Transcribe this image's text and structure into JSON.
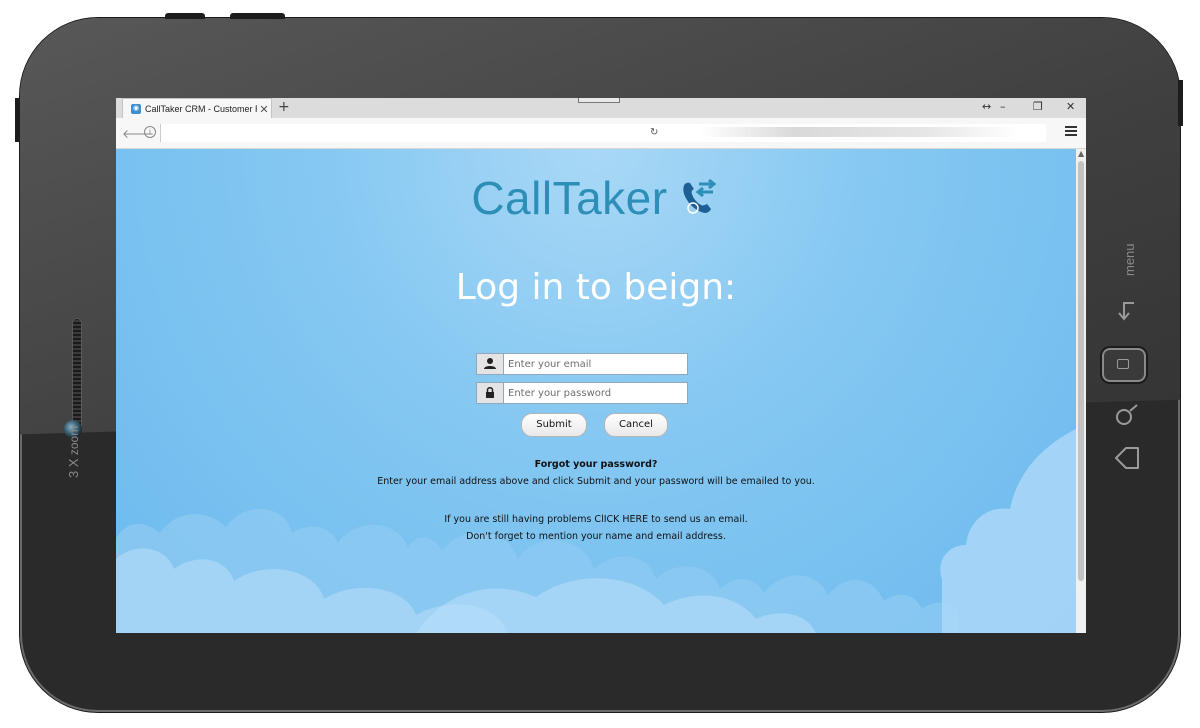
{
  "device": {
    "zoom_label": "zoom",
    "zoom_value": "3 X",
    "menu_label": "menu"
  },
  "browser": {
    "tab_title": "CallTaker CRM - Customer R",
    "tab_close": "✕",
    "new_tab": "+",
    "window_controls": {
      "resize": "↔",
      "minimize": "–",
      "restore": "❐",
      "close": "✕"
    }
  },
  "page": {
    "logo_text": "CallTaker",
    "heading": "Log in to beign:",
    "email_placeholder": "Enter your email",
    "password_placeholder": "Enter your password",
    "submit_label": "Submit",
    "cancel_label": "Cancel",
    "forgot_title": "Forgot your password?",
    "forgot_text": "Enter your email address above and click Submit and your password will be emailed to you.",
    "help_line1": "If you are still having problems ClICK HERE to send us an email.",
    "help_line2": "Don't forget to mention your name and email address."
  },
  "colors": {
    "brand": "#2d8fb8",
    "background": "#86c8f2",
    "cloud": "#a8d6f7"
  },
  "icons": [
    "user-icon",
    "lock-icon",
    "phone-transfer-icon",
    "back-arrow-icon",
    "info-icon",
    "reload-icon",
    "hamburger-menu-icon"
  ]
}
